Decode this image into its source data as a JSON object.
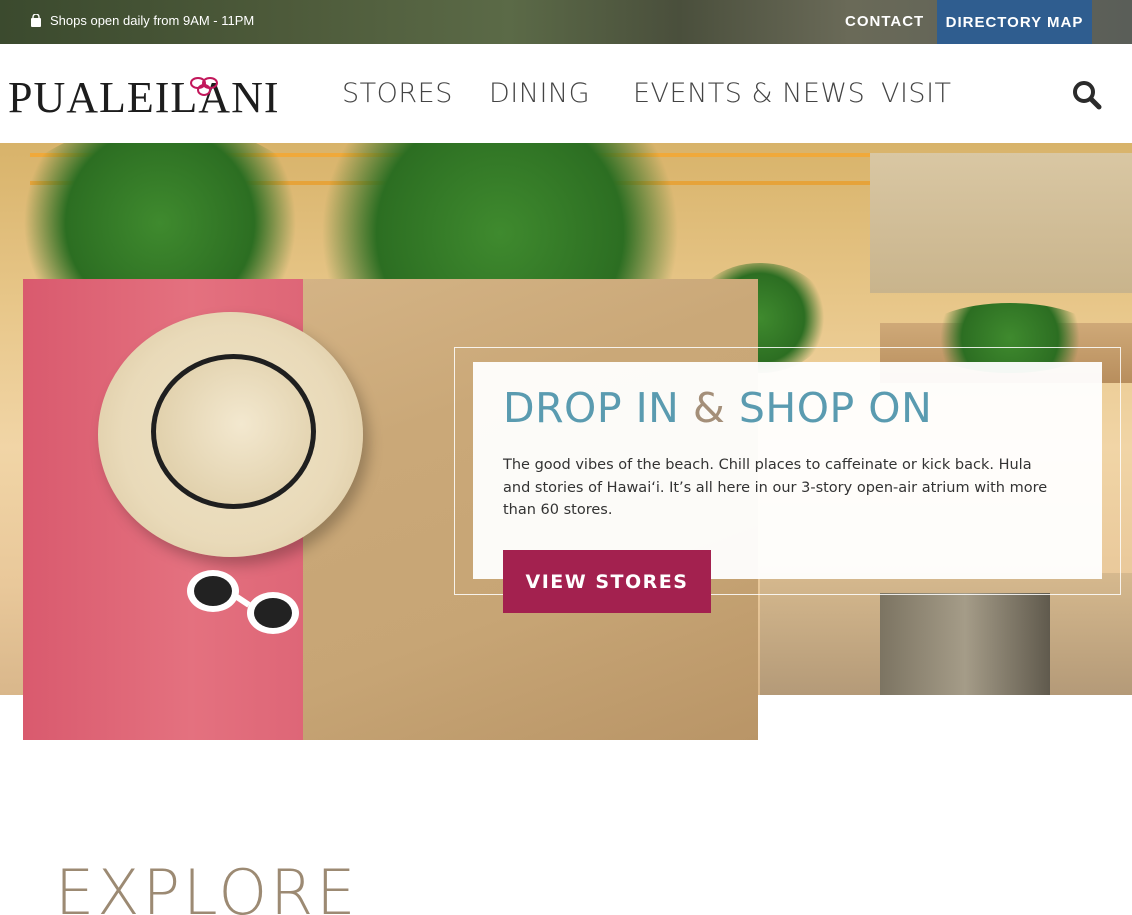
{
  "topbar": {
    "hours_text": "Shops open daily from 9AM - 11PM",
    "contact_label": "CONTACT",
    "directory_label": "DIRECTORY MAP"
  },
  "header": {
    "logo_text": "PUALEILANI",
    "nav": [
      "STORES",
      "DINING",
      "EVENTS & NEWS",
      "VISIT"
    ]
  },
  "hero": {
    "title_part1": "DROP IN ",
    "title_amp": "&",
    "title_part2": " SHOP ON",
    "description": "The good vibes of the beach. Chill places to caffeinate or kick back. Hula and stories of Hawai‘i. It’s all here in our 3-story open-air atrium with more than 60 stores.",
    "cta_label": "VIEW STORES"
  },
  "explore": {
    "heading": "EXPLORE"
  },
  "colors": {
    "accent": "#a3214f",
    "title_blue": "#5a9bb0",
    "title_tan": "#a48f79",
    "directory_bg": "#2f5d8f"
  },
  "icons": {
    "hours": "shopping-bag-icon",
    "search": "search-icon"
  }
}
